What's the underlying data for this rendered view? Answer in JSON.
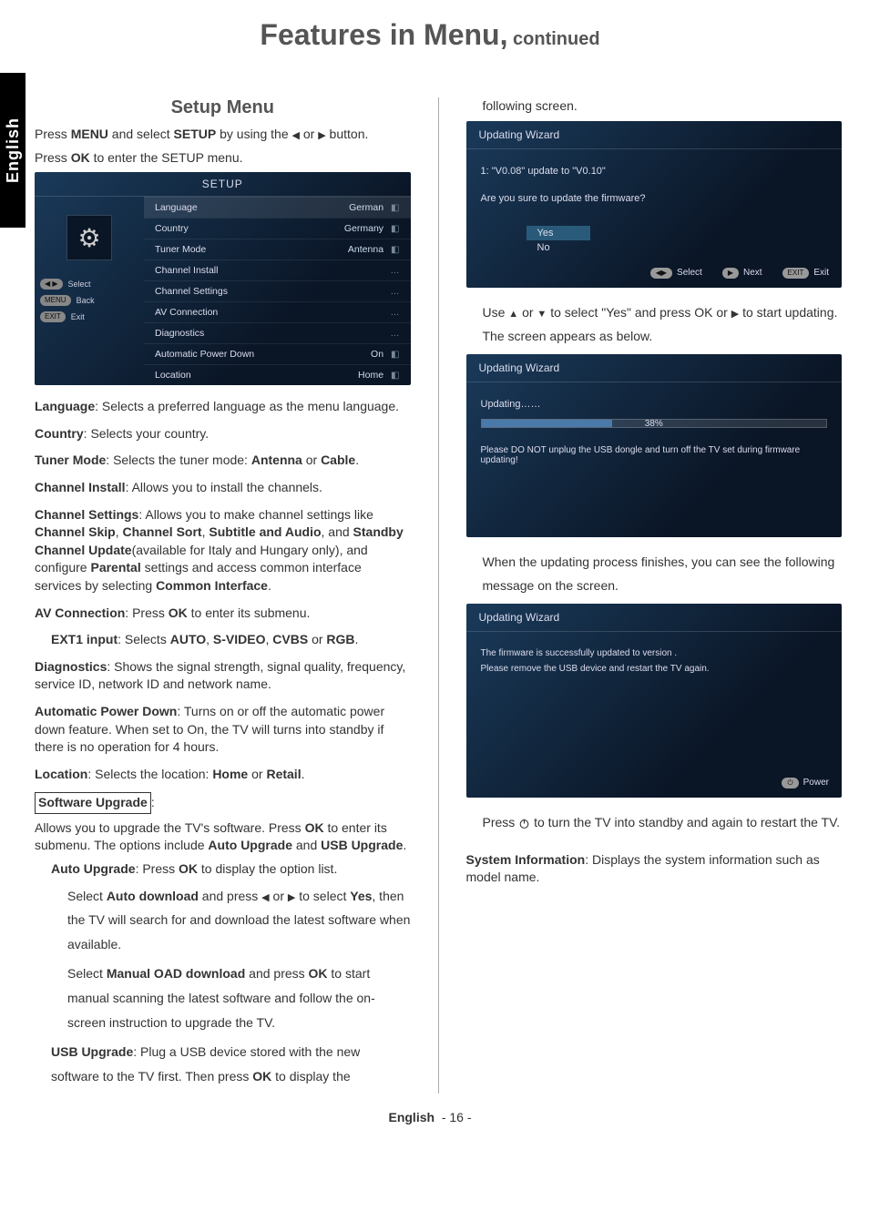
{
  "page": {
    "title_main": "Features in Menu,",
    "title_sub": " continued",
    "lang_tab": "English",
    "footer_lang": "English",
    "footer_page": "- 16 -"
  },
  "left": {
    "section_title": "Setup Menu",
    "intro_a_1": "Press ",
    "intro_a_menu": "MENU",
    "intro_a_2": " and select ",
    "intro_a_setup": "SETUP",
    "intro_a_3": " by using the ",
    "intro_a_4": " or ",
    "intro_a_5": " button.",
    "intro_b_1": "Press ",
    "intro_b_ok": "OK",
    "intro_b_2": " to enter the SETUP menu.",
    "setup_screen": {
      "header": "SETUP",
      "hints": {
        "select": "Select",
        "back": "Back",
        "exit": "Exit"
      },
      "rows": [
        {
          "label": "Language",
          "value": "German",
          "ind": "◧",
          "hi": true
        },
        {
          "label": "Country",
          "value": "Germany",
          "ind": "◧"
        },
        {
          "label": "Tuner Mode",
          "value": "Antenna",
          "ind": "◧"
        },
        {
          "label": "Channel Install",
          "value": "",
          "ind": "…"
        },
        {
          "label": "Channel Settings",
          "value": "",
          "ind": "…"
        },
        {
          "label": "AV Connection",
          "value": "",
          "ind": "…"
        },
        {
          "label": "Diagnostics",
          "value": "",
          "ind": "…"
        },
        {
          "label": "Automatic Power Down",
          "value": "On",
          "ind": "◧"
        },
        {
          "label": "Location",
          "value": "Home",
          "ind": "◧"
        }
      ]
    },
    "d_language_b": "Language",
    "d_language_t": ": Selects a preferred language as the menu language.",
    "d_country_b": "Country",
    "d_country_t": ": Selects your country.",
    "d_tuner_b": "Tuner Mode",
    "d_tuner_t1": ": Selects the tuner mode: ",
    "d_tuner_ant": "Antenna",
    "d_tuner_or": " or ",
    "d_tuner_cab": "Cable",
    "d_tuner_dot": ".",
    "d_chi_b": "Channel Install",
    "d_chi_t": ": Allows you to install the channels.",
    "d_chs_b": "Channel Settings",
    "d_chs_t1": ": Allows you to make channel settings like ",
    "d_chs_skip": "Channel Skip",
    "d_chs_c1": ", ",
    "d_chs_sort": "Channel Sort",
    "d_chs_c2": ", ",
    "d_chs_sub": "Subtitle and Audio",
    "d_chs_c3": ", and ",
    "d_chs_stb": "Standby Channel Update",
    "d_chs_t2": "(available for Italy and Hungary only), and configure ",
    "d_chs_par": "Parental",
    "d_chs_t3": " settings and access common interface services by selecting ",
    "d_chs_ci": "Common Interface",
    "d_chs_dot": ".",
    "d_av_b": "AV Connection",
    "d_av_t1": ": Press ",
    "d_av_ok": "OK",
    "d_av_t2": " to enter its submenu.",
    "d_ext_b": "EXT1 input",
    "d_ext_t1": ": Selects ",
    "d_ext_auto": "AUTO",
    "d_ext_c1": ", ",
    "d_ext_sv": "S-VIDEO",
    "d_ext_c2": ", ",
    "d_ext_cv": "CVBS",
    "d_ext_or": " or ",
    "d_ext_rgb": "RGB",
    "d_ext_dot": ".",
    "d_diag_b": "Diagnostics",
    "d_diag_t": ": Shows the signal strength, signal quality, frequency, service ID, network ID and network name.",
    "d_apd_b": "Automatic Power Down",
    "d_apd_t": ": Turns on or off the automatic power down feature. When set to On, the TV will turns into standby if there is no operation for 4 hours.",
    "d_loc_b": "Location",
    "d_loc_t1": ": Selects the location: ",
    "d_loc_home": "Home",
    "d_loc_or": " or ",
    "d_loc_ret": "Retail",
    "d_loc_dot": ".",
    "d_sw_b": "Software Upgrade",
    "d_sw_col": ":",
    "d_sw_t1": "Allows you to upgrade the TV's software. Press ",
    "d_sw_ok": "OK",
    "d_sw_t2": " to enter its submenu. The options include ",
    "d_sw_au": "Auto Upgrade",
    "d_sw_and": " and ",
    "d_sw_usb": "USB Upgrade",
    "d_sw_dot": ".",
    "d_au_b": "Auto Upgrade",
    "d_au_t1": ": Press ",
    "d_au_ok": "OK",
    "d_au_t2": " to display the option list.",
    "d_au_l1a": "Select ",
    "d_au_l1b": "Auto download",
    "d_au_l1c": " and press ",
    "d_au_l1d": " or ",
    "d_au_l1e": " to select ",
    "d_au_l1f": "Yes",
    "d_au_l1g": ", then the TV will search for and download the latest software when available.",
    "d_au_l2a": "Select ",
    "d_au_l2b": "Manual OAD download",
    "d_au_l2c": " and press ",
    "d_au_l2ok": "OK",
    "d_au_l2d": " to start manual scanning the latest software and follow the on-screen instruction to upgrade the TV.",
    "d_usb_b": "USB Upgrade",
    "d_usb_t1": ": Plug a USB device stored with the new software to the TV first. Then press ",
    "d_usb_ok": "OK",
    "d_usb_t2": " to display the"
  },
  "right": {
    "cont_text": "following screen.",
    "wiz1": {
      "title": "Updating Wizard",
      "line1": "1: \"V0.08\" update to \"V0.10\"",
      "line2": "Are you sure to update the firmware?",
      "yes": "Yes",
      "no": "No",
      "foot_select": "Select",
      "foot_next": "Next",
      "foot_exit": "Exit"
    },
    "after_wiz1_a": "Use ",
    "after_wiz1_b": " or ",
    "after_wiz1_c": " to select \"Yes\" and press OK or ",
    "after_wiz1_d": " to start updating. The screen appears as below.",
    "wiz2": {
      "title": "Updating Wizard",
      "updating": "Updating……",
      "percent": "38%",
      "warn": "Please DO NOT unplug the USB dongle and turn off the TV set during firmware updating!"
    },
    "after_wiz2": "When the updating process finishes, you can see the following message on the screen.",
    "wiz3": {
      "title": "Updating Wizard",
      "msg1": "The firmware is successfully updated to version .",
      "msg2": "Please remove the USB device and restart the TV again.",
      "foot_power": "Power"
    },
    "after_wiz3_a": "Press ",
    "after_wiz3_b": " to turn the TV into standby and again to restart the TV.",
    "sysinfo_b": "System Information",
    "sysinfo_t": ": Displays the system information such as model name."
  }
}
